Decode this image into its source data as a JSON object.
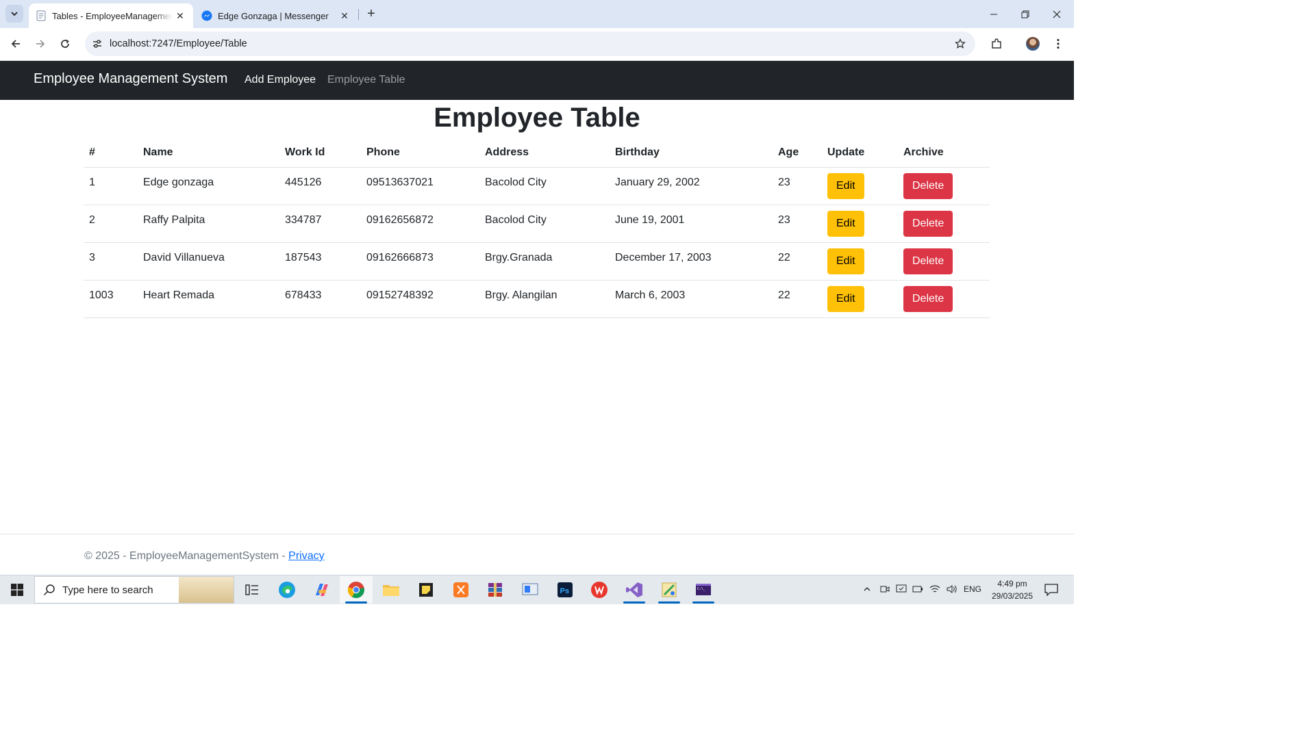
{
  "browser": {
    "tabs": [
      {
        "title": "Tables - EmployeeManagementSystem",
        "active": true
      },
      {
        "title": "Edge Gonzaga | Messenger",
        "active": false
      }
    ],
    "url": "localhost:7247/Employee/Table"
  },
  "navbar": {
    "brand": "Employee Management System",
    "links": [
      {
        "label": "Add Employee",
        "active": true
      },
      {
        "label": "Employee Table",
        "active": false
      }
    ]
  },
  "page": {
    "title": "Employee Table"
  },
  "table": {
    "headers": [
      "#",
      "Name",
      "Work Id",
      "Phone",
      "Address",
      "Birthday",
      "Age",
      "Update",
      "Archive"
    ],
    "rows": [
      {
        "id": "1",
        "name": "Edge gonzaga",
        "work_id": "445126",
        "phone": "09513637021",
        "address": "Bacolod City",
        "birthday": "January 29, 2002",
        "age": "23"
      },
      {
        "id": "2",
        "name": "Raffy Palpita",
        "work_id": "334787",
        "phone": "09162656872",
        "address": "Bacolod City",
        "birthday": "June 19, 2001",
        "age": "23"
      },
      {
        "id": "3",
        "name": "David Villanueva",
        "work_id": "187543",
        "phone": "09162666873",
        "address": "Brgy.Granada",
        "birthday": "December 17, 2003",
        "age": "22"
      },
      {
        "id": "1003",
        "name": "Heart Remada",
        "work_id": "678433",
        "phone": "09152748392",
        "address": "Brgy. Alangilan",
        "birthday": "March 6, 2003",
        "age": "22"
      }
    ],
    "edit_label": "Edit",
    "delete_label": "Delete"
  },
  "footer": {
    "text": "© 2025 - EmployeeManagementSystem - ",
    "privacy_label": "Privacy"
  },
  "taskbar": {
    "search_placeholder": "Type here to search",
    "apps": [
      "task-view",
      "edge",
      "copilot",
      "chrome",
      "file-explorer",
      "sticky-notes",
      "xampp",
      "winrar",
      "remote-desktop",
      "photoshop",
      "wps-office",
      "visual-studio",
      "paint-app",
      "terminal"
    ],
    "language": "ENG",
    "time": "4:49 pm",
    "date": "29/03/2025"
  },
  "colors": {
    "navbar_bg": "#212529",
    "edit_button": "#ffc107",
    "delete_button": "#dc3545",
    "link": "#0d6efd"
  }
}
